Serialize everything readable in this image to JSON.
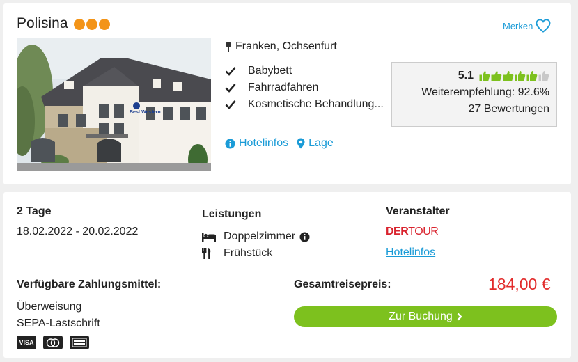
{
  "hotel": {
    "name": "Polisina",
    "stars": 3,
    "merken_label": "Merken",
    "location": "Franken, Ochsenfurt",
    "features": [
      "Babybett",
      "Fahrradfahren",
      "Kosmetische Behandlung..."
    ],
    "links": {
      "hotelinfos": "Hotelinfos",
      "lage": "Lage"
    },
    "image_sign": "Best Western"
  },
  "rating": {
    "score": "5.1",
    "thumbs_filled": 5,
    "thumbs_total": 6,
    "recommendation": "Weiterempfehlung: 92.6%",
    "reviews": "27 Bewertungen"
  },
  "offer": {
    "duration": "2 Tage",
    "dates": "18.02.2022 - 20.02.2022",
    "services_title": "Leistungen",
    "services": [
      "Doppelzimmer",
      "Frühstück"
    ],
    "operator_title": "Veranstalter",
    "operator_logo": {
      "der": "DER",
      "tour": "TOUR"
    },
    "operator_link": "Hotelinfos",
    "payment_title": "Verfügbare Zahlungsmittel:",
    "payment_methods": [
      "Überweisung",
      "SEPA-Lastschrift"
    ],
    "payment_cards": [
      "VISA",
      "Mastercard",
      "American Express"
    ],
    "total_label": "Gesamtreisepreis:",
    "price": "184,00 €",
    "book_label": "Zur Buchung"
  },
  "colors": {
    "accent": "#1a9bd7",
    "star": "#f39418",
    "thumb_green": "#7dc11e",
    "price_red": "#e22b2b",
    "button_green": "#7dc11e"
  }
}
